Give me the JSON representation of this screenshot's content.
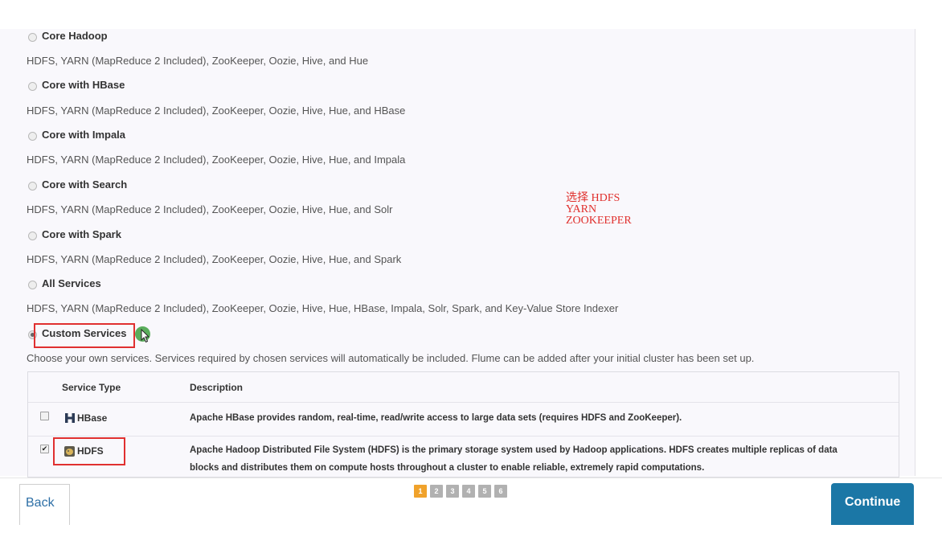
{
  "options": [
    {
      "title": "Core Hadoop",
      "description": "HDFS, YARN (MapReduce 2 Included), ZooKeeper, Oozie, Hive, and Hue"
    },
    {
      "title": "Core with HBase",
      "description": "HDFS, YARN (MapReduce 2 Included), ZooKeeper, Oozie, Hive, Hue, and HBase"
    },
    {
      "title": "Core with Impala",
      "description": "HDFS, YARN (MapReduce 2 Included), ZooKeeper, Oozie, Hive, Hue, and Impala"
    },
    {
      "title": "Core with Search",
      "description": "HDFS, YARN (MapReduce 2 Included), ZooKeeper, Oozie, Hive, Hue, and Solr"
    },
    {
      "title": "Core with Spark",
      "description": "HDFS, YARN (MapReduce 2 Included), ZooKeeper, Oozie, Hive, Hue, and Spark"
    },
    {
      "title": "All Services",
      "description": "HDFS, YARN (MapReduce 2 Included), ZooKeeper, Oozie, Hive, Hue, HBase, Impala, Solr, Spark, and Key-Value Store Indexer"
    },
    {
      "title": "Custom Services",
      "description": "Choose your own services. Services required by chosen services will automatically be included. Flume can be added after your initial cluster has been set up."
    }
  ],
  "selected_option": "Custom Services",
  "annotation": {
    "line1": "选择 HDFS",
    "line2": "YARN",
    "line3": "ZOOKEEPER",
    "color": "#e0302d"
  },
  "table": {
    "headers": {
      "service_type": "Service Type",
      "description": "Description"
    },
    "rows": [
      {
        "service": "HBase",
        "icon": "hbase-logo-icon",
        "checked": false,
        "description": "Apache HBase provides random, real-time, read/write access to large data sets (requires HDFS and ZooKeeper)."
      },
      {
        "service": "HDFS",
        "icon": "hdfs-logo-icon",
        "checked": true,
        "description_line1": "Apache Hadoop Distributed File System (HDFS) is the primary storage system used by Hadoop applications. HDFS creates multiple replicas of data",
        "description_line2": "blocks and distributes them on compute hosts throughout a cluster to enable reliable, extremely rapid computations."
      }
    ]
  },
  "footer": {
    "back_label": "Back",
    "continue_label": "Continue",
    "pages": [
      "1",
      "2",
      "3",
      "4",
      "5",
      "6"
    ],
    "current_page": "1"
  },
  "colors": {
    "accent": "#1b77a6",
    "page_active": "#f0a22b",
    "highlight_box": "#e03030"
  }
}
